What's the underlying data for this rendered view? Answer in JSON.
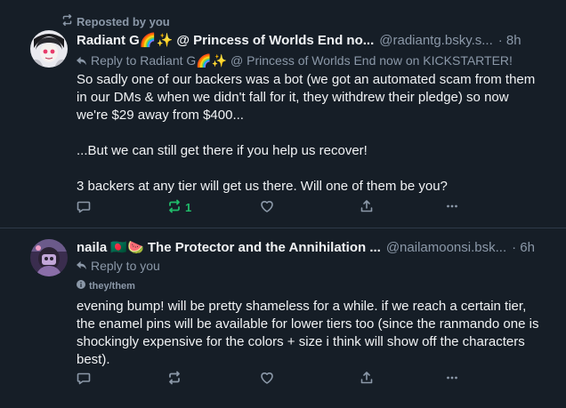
{
  "posts": [
    {
      "repost_label": "Reposted by you",
      "author_name": "Radiant G🌈✨ @ Princess of Worlds End no...",
      "handle": "@radiantg.bsky.s...",
      "time": "· 8h",
      "reply_to": "Reply to Radiant G🌈✨ @ Princess of Worlds End now on KICKSTARTER!",
      "text": "So sadly one of our backers was a bot (we got an automated scam from them in our DMs & when we didn't fall for it, they withdrew their pledge) so now we're $29 away from $400...\n\n...But we can still get there if you help us recover!\n\n3 backers at any tier will get us there. Will one of them be you?",
      "repost_count": "1",
      "repost_color": "#20bc6a",
      "icons": [
        "repost-icon",
        "reply-arrow-icon",
        "comment-icon",
        "repost-icon",
        "heart-icon",
        "share-icon",
        "more-icon"
      ]
    },
    {
      "author_name": "naila 🇧🇩🍉 The Protector and the Annihilation ...",
      "handle": "@nailamoonsi.bsk...",
      "time": "· 6h",
      "reply_to": "Reply to you",
      "pronouns": "they/them",
      "text": "evening bump! will be pretty shameless for a while. if we reach a certain tier, the enamel pins will be available for lower tiers too (since the ranmando one is shockingly expensive for the colors + size i think will show off the characters best).",
      "icons": [
        "reply-arrow-icon",
        "info-icon",
        "comment-icon",
        "repost-icon",
        "heart-icon",
        "share-icon",
        "more-icon"
      ]
    }
  ],
  "colors": {
    "background": "#161e27",
    "text": "#f1f3f5",
    "muted": "#8b98a8",
    "repost_active": "#20bc6a",
    "divider": "#2e3a48"
  }
}
